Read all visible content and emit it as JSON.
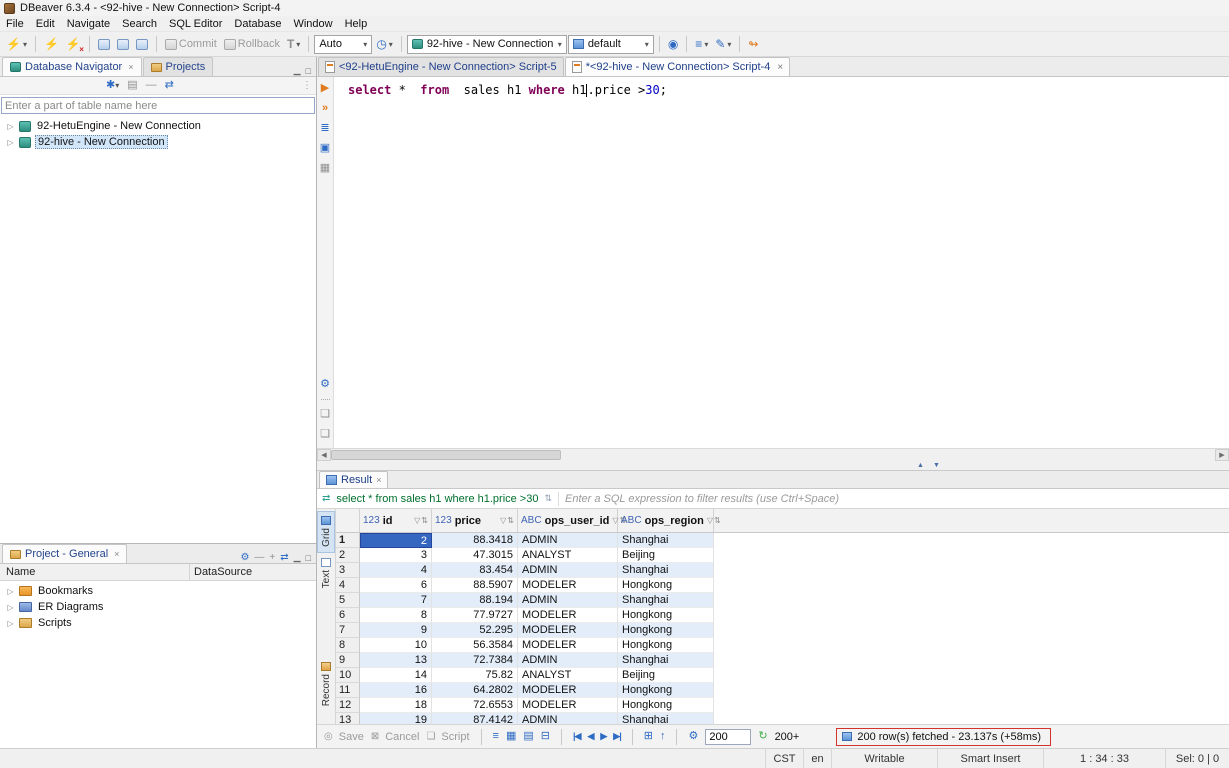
{
  "window": {
    "title": "DBeaver 6.3.4 - <92-hive - New Connection> Script-4"
  },
  "menu": {
    "items": [
      "File",
      "Edit",
      "Navigate",
      "Search",
      "SQL Editor",
      "Database",
      "Window",
      "Help"
    ]
  },
  "toolbar": {
    "commit": "Commit",
    "rollback": "Rollback",
    "transaction_mode": "T",
    "autocommit": "Auto",
    "connection": "92-hive - New Connection",
    "schema": "default"
  },
  "navigator": {
    "tabs": {
      "database": "Database Navigator",
      "projects": "Projects"
    },
    "filter_placeholder": "Enter a part of table name here",
    "items": [
      {
        "label": "92-HetuEngine - New Connection"
      },
      {
        "label": "92-hive - New Connection"
      }
    ]
  },
  "project": {
    "tab": "Project - General",
    "columns": {
      "name": "Name",
      "datasource": "DataSource"
    },
    "items": [
      {
        "label": "Bookmarks"
      },
      {
        "label": "ER Diagrams"
      },
      {
        "label": "Scripts"
      }
    ]
  },
  "editor": {
    "tabs": [
      {
        "label": "<92-HetuEngine - New Connection> Script-5"
      },
      {
        "label": "*<92-hive - New Connection> Script-4"
      }
    ],
    "sql_tokens": [
      {
        "t": "select",
        "c": "kw"
      },
      {
        "t": " *  ",
        "c": "plain"
      },
      {
        "t": "from",
        "c": "kw"
      },
      {
        "t": "  sales h1 ",
        "c": "plain"
      },
      {
        "t": "where",
        "c": "kw"
      },
      {
        "t": " h1",
        "c": "plain"
      },
      {
        "t": "",
        "c": "caret"
      },
      {
        "t": ".price >",
        "c": "plain"
      },
      {
        "t": "30",
        "c": "num"
      },
      {
        "t": ";",
        "c": "plain"
      }
    ]
  },
  "result": {
    "tab": "Result",
    "filter": {
      "sql": "select * from sales h1 where h1.price >30",
      "placeholder": "Enter a SQL expression to filter results (use Ctrl+Space)"
    },
    "side_tabs": [
      "Grid",
      "Text",
      "Record"
    ],
    "grid": {
      "columns": [
        {
          "type": "123",
          "name": "id"
        },
        {
          "type": "123",
          "name": "price"
        },
        {
          "type": "ABC",
          "name": "ops_user_id"
        },
        {
          "type": "ABC",
          "name": "ops_region"
        }
      ],
      "rows": [
        [
          1,
          "2",
          "88.3418",
          "ADMIN",
          "Shanghai"
        ],
        [
          2,
          "3",
          "47.3015",
          "ANALYST",
          "Beijing"
        ],
        [
          3,
          "4",
          "83.454",
          "ADMIN",
          "Shanghai"
        ],
        [
          4,
          "6",
          "88.5907",
          "MODELER",
          "Hongkong"
        ],
        [
          5,
          "7",
          "88.194",
          "ADMIN",
          "Shanghai"
        ],
        [
          6,
          "8",
          "77.9727",
          "MODELER",
          "Hongkong"
        ],
        [
          7,
          "9",
          "52.295",
          "MODELER",
          "Hongkong"
        ],
        [
          8,
          "10",
          "56.3584",
          "MODELER",
          "Hongkong"
        ],
        [
          9,
          "13",
          "72.7384",
          "ADMIN",
          "Shanghai"
        ],
        [
          10,
          "14",
          "75.82",
          "ANALYST",
          "Beijing"
        ],
        [
          11,
          "16",
          "64.2802",
          "MODELER",
          "Hongkong"
        ],
        [
          12,
          "18",
          "72.6553",
          "MODELER",
          "Hongkong"
        ],
        [
          13,
          "19",
          "87.4142",
          "ADMIN",
          "Shanghai"
        ]
      ]
    },
    "toolbar": {
      "save": "Save",
      "cancel": "Cancel",
      "script": "Script",
      "fetch_size": "200",
      "fetch_more": "200+",
      "status": "200 row(s) fetched - 23.137s (+58ms)"
    }
  },
  "statusbar": {
    "items": [
      "CST",
      "en",
      "Writable",
      "Smart Insert",
      "1 : 34 : 33",
      "Sel: 0 | 0"
    ]
  }
}
